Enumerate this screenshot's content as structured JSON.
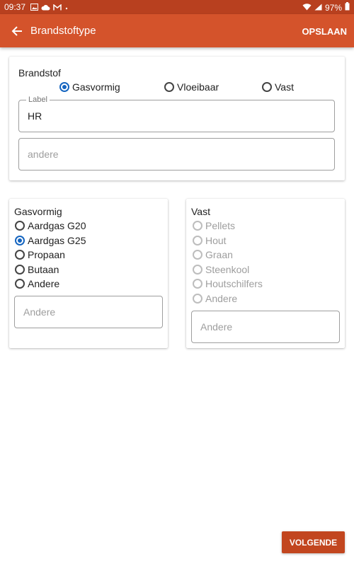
{
  "status_bar": {
    "time": "09:37",
    "battery": "97%",
    "left_icons": [
      "image-icon",
      "cloud-icon",
      "gmail-icon",
      "dot-icon"
    ],
    "right_icons": [
      "wifi-icon",
      "signal-icon",
      "battery-icon"
    ]
  },
  "app_bar": {
    "title": "Brandstoftype",
    "save_label": "OPSLAAN",
    "color": "#d4532b"
  },
  "brandstof_card": {
    "heading": "Brandstof",
    "options": [
      {
        "label": "Gasvormig",
        "checked": true
      },
      {
        "label": "Vloeibaar",
        "checked": false
      },
      {
        "label": "Vast",
        "checked": false
      }
    ],
    "label_field": {
      "floating_label": "Label",
      "value": "HR"
    },
    "andere_field": {
      "placeholder": "andere"
    }
  },
  "gasvormig_card": {
    "heading": "Gasvormig",
    "options": [
      {
        "label": "Aardgas G20",
        "checked": false
      },
      {
        "label": "Aardgas G25",
        "checked": true
      },
      {
        "label": "Propaan",
        "checked": false
      },
      {
        "label": "Butaan",
        "checked": false
      },
      {
        "label": "Andere",
        "checked": false
      }
    ],
    "other_placeholder": "Andere"
  },
  "vast_card": {
    "heading": "Vast",
    "options": [
      {
        "label": "Pellets",
        "checked": false
      },
      {
        "label": "Hout",
        "checked": false
      },
      {
        "label": "Graan",
        "checked": false
      },
      {
        "label": "Steenkool",
        "checked": false
      },
      {
        "label": "Houtschilfers",
        "checked": false
      },
      {
        "label": "Andere",
        "checked": false
      }
    ],
    "other_placeholder": "Andere",
    "disabled": true
  },
  "next_button": {
    "label": "VOLGENDE",
    "color": "#c2461f"
  },
  "colors": {
    "radio_checked": "#1565c0",
    "status_bar": "#b8401f"
  }
}
